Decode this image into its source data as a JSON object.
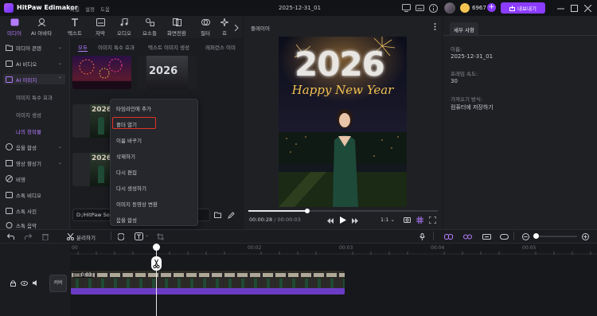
{
  "app": {
    "name": "HitPaw Edimakor",
    "project_title": "2025-12-31_01"
  },
  "menu": [
    "파일",
    "설정",
    "도움"
  ],
  "account": {
    "credits": "6967",
    "export_label": "내보내기"
  },
  "toolbar": [
    {
      "label": "미디어",
      "icon": "media-icon",
      "active": true
    },
    {
      "label": "AI 아바타",
      "icon": "avatar-icon"
    },
    {
      "label": "텍스트",
      "icon": "text-icon"
    },
    {
      "label": "자막",
      "icon": "subtitle-icon"
    },
    {
      "label": "오디오",
      "icon": "audio-icon"
    },
    {
      "label": "요소들",
      "icon": "elements-icon"
    },
    {
      "label": "화면전환",
      "icon": "transition-icon"
    },
    {
      "label": "필터",
      "icon": "filter-icon"
    },
    {
      "label": "효",
      "icon": "effect-icon"
    }
  ],
  "sidebar": {
    "items": [
      {
        "label": "미디어 콘텐",
        "icon": "folder-icon"
      },
      {
        "label": "AI 비디오",
        "icon": "ai-video-icon"
      },
      {
        "label": "AI 이미지",
        "icon": "ai-image-icon",
        "open": true
      }
    ],
    "sub_items": [
      "이미지 특수 효과",
      "이미지 생성",
      "나의 창작물"
    ],
    "items_after": [
      {
        "label": "음을 합성",
        "icon": "audio-synth-icon"
      },
      {
        "label": "영상 향상기",
        "icon": "enhance-icon"
      },
      {
        "label": "비영",
        "icon": "empty-icon"
      },
      {
        "label": "스톡 비디오",
        "icon": "stock-video-icon"
      },
      {
        "label": "스톡 사진",
        "icon": "stock-photo-icon"
      },
      {
        "label": "스톡 음악",
        "icon": "stock-music-icon"
      }
    ]
  },
  "media_tabs": [
    "모두",
    "이미지 특수 효과",
    "텍스트 이미지 생성",
    "레퍼런스 이미"
  ],
  "thumbnails": [
    {
      "text": "2026"
    },
    {
      "text": "2026"
    },
    {
      "text": "2026"
    },
    {
      "text": "2026"
    }
  ],
  "path_text": "D:/HitPaw So",
  "context_menu": {
    "items": [
      "타임라인에 추가",
      "폴더 열기",
      "이름 바꾸기",
      "삭제하기",
      "다시 편집",
      "다시 생성하기",
      "이미지 동영상 변환",
      "음을 합성"
    ],
    "highlighted_index": 1
  },
  "preview": {
    "title": "플레이어",
    "time_current": "00:00:28",
    "time_total": "00:00:03",
    "ratio": "1:1",
    "progress": 0.31,
    "video_headline": "2026",
    "video_subline": "Happy New Year"
  },
  "right_panel": {
    "tab": "세부 사항",
    "fields": [
      {
        "label": "이름:",
        "value": "2025-12-31_01"
      },
      {
        "label": "프레임 속도:",
        "value": "30"
      },
      {
        "label": "가져오기 방식:",
        "value": "컴퓨터에 저장하기"
      }
    ]
  },
  "timeline": {
    "split_label": "분리하기",
    "ruler": [
      "00",
      "00:02",
      "00:03",
      "00:04",
      "00:05"
    ],
    "clip_time": "0:03",
    "cover_label": "커버"
  },
  "colors": {
    "accent": "#8b3cff",
    "highlight_border": "#e0322b"
  }
}
